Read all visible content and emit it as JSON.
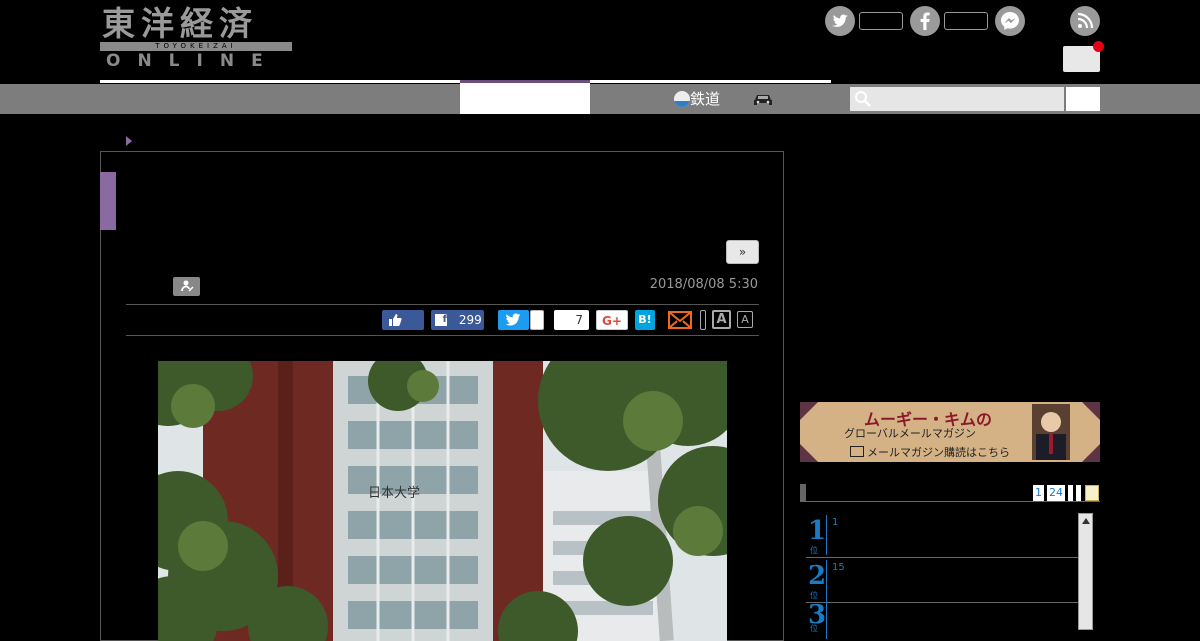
{
  "header": {
    "logo_jp": "東洋経済",
    "logo_bar": "TOYOKEIZAI",
    "logo_en": "ONLINE"
  },
  "social": {
    "twitter_icon": "twitter-bird-icon",
    "facebook_icon": "facebook-f-icon",
    "messenger_icon": "messenger-icon",
    "rss_icon": "rss-icon"
  },
  "nav": {
    "railway_label": "鉄道"
  },
  "article": {
    "next_label": "»",
    "date": "2018/08/08 5:30",
    "share": {
      "fb_count": "299",
      "comment_count": "7",
      "gplus_label": "G+",
      "hatena_label": "B!",
      "font_large": "A",
      "font_small": "A"
    }
  },
  "banner": {
    "title": "ムーギー・キムの",
    "subtitle": "グローバルメールマガジン",
    "cta": "メールマガジン購読はこちら"
  },
  "ranking": {
    "tabs": [
      "1",
      "24"
    ],
    "rows": [
      {
        "rank": "1",
        "unit": "位",
        "count": "1"
      },
      {
        "rank": "2",
        "unit": "位",
        "count": "15"
      },
      {
        "rank": "3",
        "unit": "位",
        "count": ""
      }
    ]
  },
  "photo": {
    "sign_text": "日本大学"
  },
  "colors": {
    "accent_purple": "#8a6aa0",
    "nav_gray": "#7d7d7d",
    "ranking_blue": "#1a7bc4",
    "alert_red": "#e60012"
  }
}
